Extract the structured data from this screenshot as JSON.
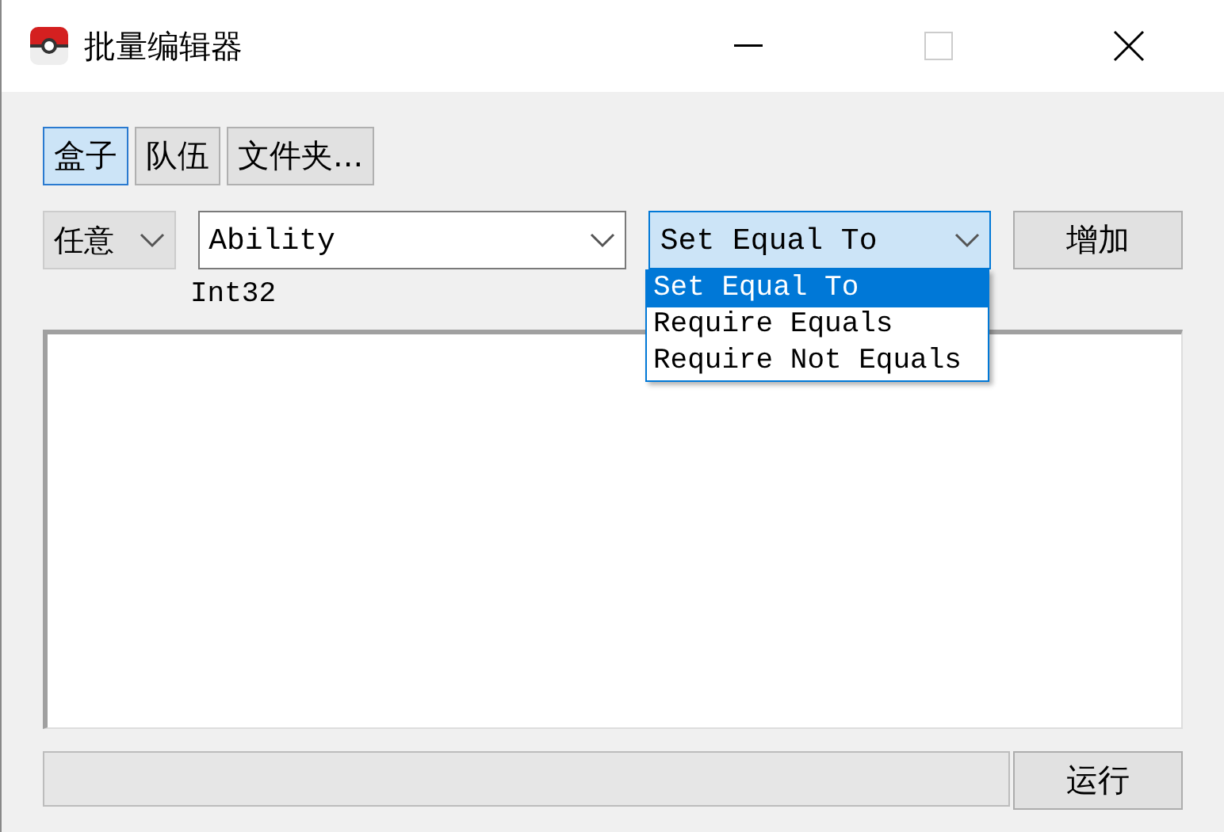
{
  "window": {
    "title": "批量编辑器"
  },
  "tabs": [
    {
      "label": "盒子",
      "selected": true
    },
    {
      "label": "队伍",
      "selected": false
    },
    {
      "label": "文件夹...",
      "selected": false
    }
  ],
  "filter": {
    "mode": "任意",
    "property": "Ability",
    "type": "Int32",
    "operation": "Set Equal To",
    "add_button": "增加"
  },
  "operation_options": [
    {
      "label": "Set Equal To",
      "selected": true
    },
    {
      "label": "Require Equals",
      "selected": false
    },
    {
      "label": "Require Not Equals",
      "selected": false
    }
  ],
  "run_button": "运行"
}
